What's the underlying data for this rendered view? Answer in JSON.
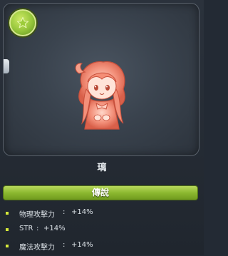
{
  "item": {
    "name": "璃",
    "grade": "傳說"
  },
  "stats": [
    {
      "label": "物理攻擊力",
      "value": "+14%"
    },
    {
      "label": "STR",
      "value": "+14%"
    },
    {
      "label": "魔法攻擊力",
      "value": "+14%"
    }
  ],
  "separator": ":",
  "colors": {
    "accent_green": "#8cb830",
    "background": "#232a34",
    "card_bg": "#3a434e",
    "bullet": "#d6ea3a",
    "character_tint": "#f08070"
  },
  "icons": {
    "badge": "star-icon",
    "card_tab": "tab-handle-icon"
  }
}
